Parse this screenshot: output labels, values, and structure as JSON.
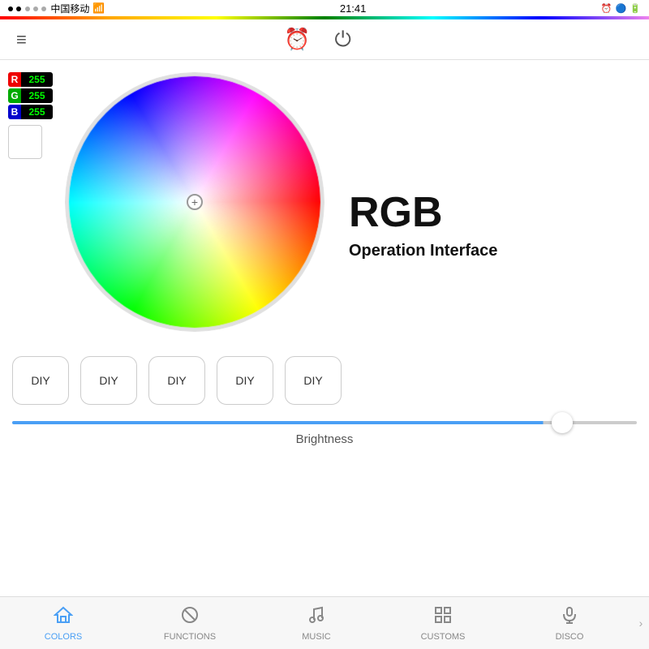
{
  "statusBar": {
    "carrier": "中国移动",
    "time": "21:41",
    "batteryIcon": "🔋"
  },
  "topNav": {
    "menuIcon": "≡",
    "alarmIcon": "⏰",
    "powerIcon": "⏻"
  },
  "rgbValues": {
    "r": {
      "label": "R",
      "value": "255"
    },
    "g": {
      "label": "G",
      "value": "255"
    },
    "b": {
      "label": "B",
      "value": "255"
    }
  },
  "mainText": {
    "title": "RGB",
    "subtitle1": "Operation Interface"
  },
  "diyButtons": [
    {
      "label": "DIY"
    },
    {
      "label": "DIY"
    },
    {
      "label": "DIY"
    },
    {
      "label": "DIY"
    },
    {
      "label": "DIY"
    }
  ],
  "brightness": {
    "label": "Brightness",
    "value": 85
  },
  "bottomNav": {
    "items": [
      {
        "id": "colors",
        "label": "COLORS",
        "icon": "⌂",
        "active": true
      },
      {
        "id": "functions",
        "label": "FUNCTIONS",
        "icon": "⊘"
      },
      {
        "id": "music",
        "label": "MUSIC",
        "icon": "♪"
      },
      {
        "id": "customs",
        "label": "CUSTOMS",
        "icon": "⊞"
      },
      {
        "id": "disco",
        "label": "DISCO",
        "icon": "🎤"
      }
    ]
  }
}
